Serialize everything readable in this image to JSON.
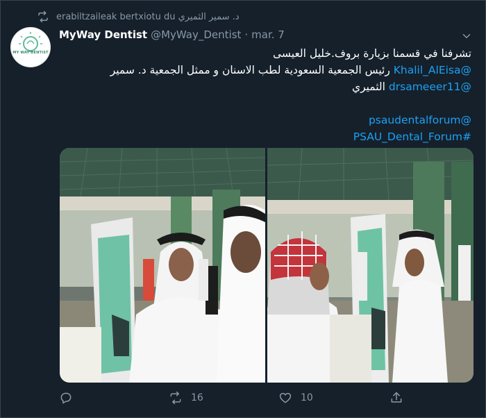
{
  "retweet": {
    "icon": "retweet-icon",
    "text": "erabiltzaileak bertxiotu du د. سمير الثميري"
  },
  "tweet": {
    "author_name": "MyWay Dentist",
    "author_handle": "@MyWay_Dentist",
    "separator": "·",
    "date": "mar. 7",
    "avatar_text": "MY WAY DENTIST",
    "lines": [
      {
        "text": "تشرفنا في قسمنا بزيارة بروف.خليل العيسى",
        "link": ""
      },
      {
        "text": "رئيس الجمعية السعودية لطب الاسنان و ممثل الجمعية د. سمير",
        "link": "@Khalil_AlEisa"
      },
      {
        "text": "الثميري",
        "link": "@drsameeer11"
      },
      {
        "text": "",
        "link": ""
      },
      {
        "text": "",
        "link": "@psaudentalforum"
      },
      {
        "text": "",
        "link": "#PSAU_Dental_Forum"
      }
    ]
  },
  "actions": {
    "reply_count": "",
    "retweet_count": "16",
    "like_count": "10"
  },
  "colors": {
    "background": "#15202b",
    "border": "#38444d",
    "secondary_text": "#8899a6",
    "link": "#1da1f2"
  }
}
